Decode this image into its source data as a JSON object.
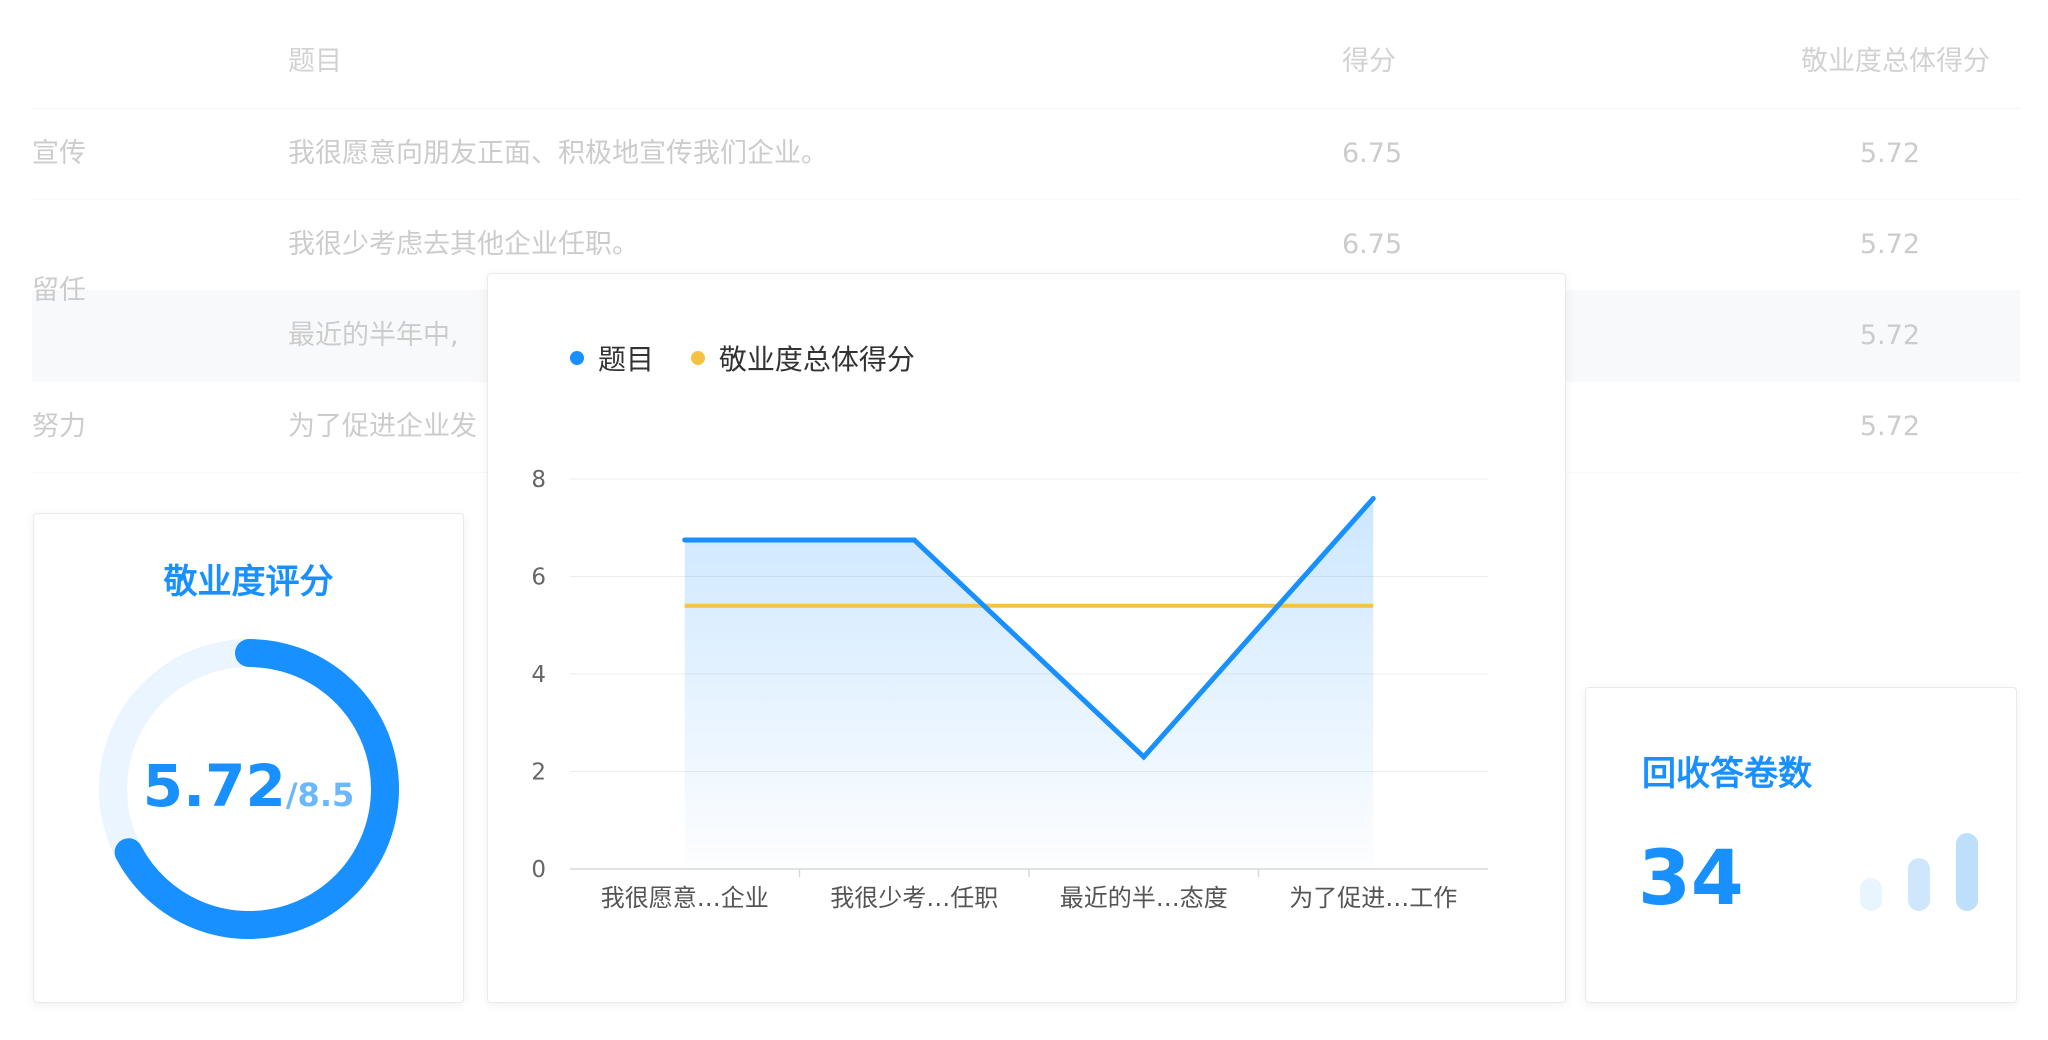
{
  "table": {
    "headers": {
      "question": "题目",
      "score": "得分",
      "total": "敬业度总体得分"
    },
    "rows": [
      {
        "dimension": "宣传",
        "question": "我很愿意向朋友正面、积极地宣传我们企业。",
        "score": "6.75",
        "total": "5.72"
      },
      {
        "dimension": "",
        "question": "我很少考虑去其他企业任职。",
        "score": "6.75",
        "total": "5.72"
      },
      {
        "dimension": "留任",
        "question": "最近的半年中,",
        "score": "",
        "total": "5.72"
      },
      {
        "dimension": "努力",
        "question": "为了促进企业发",
        "score": "",
        "total": "5.72"
      }
    ]
  },
  "gauge": {
    "title": "敬业度评分",
    "value": "5.72",
    "max_label": "/8.5",
    "value_num": 5.72,
    "max_num": 8.5,
    "color": "#1890ff",
    "track_color": "#eaf5ff"
  },
  "count": {
    "title": "回收答卷数",
    "value": "34",
    "icon": "bar-chart-icon"
  },
  "chart_data": {
    "type": "area",
    "title": "",
    "xlabel": "",
    "ylabel": "",
    "categories": [
      "我很愿意…企业",
      "我很少考…任职",
      "最近的半…态度",
      "为了促进…工作"
    ],
    "ylim": [
      0,
      8
    ],
    "yticks": [
      0,
      2,
      4,
      6,
      8
    ],
    "grid": true,
    "legend_position": "top-left",
    "series": [
      {
        "name": "题目",
        "values": [
          6.75,
          6.75,
          2.3,
          7.6
        ],
        "color": "#1890ff"
      },
      {
        "name": "敬业度总体得分",
        "values": [
          5.4,
          5.4,
          5.4,
          5.4
        ],
        "color": "#f5c242"
      }
    ]
  }
}
